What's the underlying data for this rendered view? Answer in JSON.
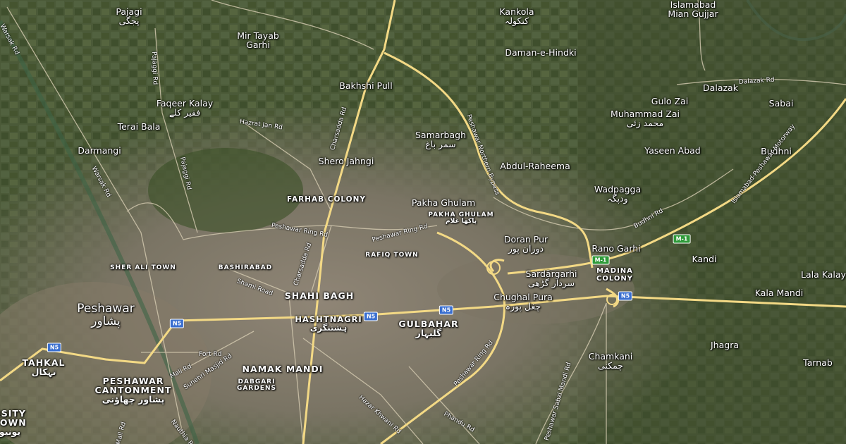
{
  "map": {
    "colors": {
      "terrain": "#4a5238",
      "urban": "#8a7f70",
      "highway": "#f3d985",
      "road": "#d8cdb4",
      "n5_shield": "#3a6fd0",
      "m1_shield": "#2f9a3a"
    },
    "places": [
      {
        "id": "pajagi",
        "en": "Pajagi",
        "ur": "پجگی"
      },
      {
        "id": "mir-tayab-garhi",
        "en": "Mir Tayab\nGarhi",
        "ur": ""
      },
      {
        "id": "kankola",
        "en": "Kankola",
        "ur": "کنکولہ"
      },
      {
        "id": "islamabad-mian-gujjar",
        "en": "Islamabad\nMian Gujjar",
        "ur": ""
      },
      {
        "id": "daman-e-hindki",
        "en": "Daman-e-Hindki",
        "ur": ""
      },
      {
        "id": "bakhshi-pull",
        "en": "Bakhshi Pull",
        "ur": ""
      },
      {
        "id": "faqeer-kalay",
        "en": "Faqeer Kalay",
        "ur": "فقیر کلے"
      },
      {
        "id": "terai-bala",
        "en": "Terai Bala",
        "ur": ""
      },
      {
        "id": "darmangi",
        "en": "Darmangi",
        "ur": ""
      },
      {
        "id": "dalazak",
        "en": "Dalazak",
        "ur": ""
      },
      {
        "id": "gulo-zai",
        "en": "Gulo Zai",
        "ur": ""
      },
      {
        "id": "sabai",
        "en": "Sabai",
        "ur": ""
      },
      {
        "id": "muhammad-zai",
        "en": "Muhammad Zai",
        "ur": "محمد زئی"
      },
      {
        "id": "samarbagh",
        "en": "Samarbagh",
        "ur": "سمر باغ"
      },
      {
        "id": "shero-jahngi",
        "en": "Shero Jahngi",
        "ur": ""
      },
      {
        "id": "yaseen-abad",
        "en": "Yaseen Abad",
        "ur": ""
      },
      {
        "id": "budhni",
        "en": "Budhni",
        "ur": ""
      },
      {
        "id": "abdul-raheema",
        "en": "Abdul-Raheema",
        "ur": ""
      },
      {
        "id": "wadpagga",
        "en": "Wadpagga",
        "ur": "ودپگہ"
      },
      {
        "id": "pakha-ghulam",
        "en": "Pakha Ghulam",
        "ur": ""
      },
      {
        "id": "doran-pur",
        "en": "Doran Pur",
        "ur": "دوران پور"
      },
      {
        "id": "rano-garhi",
        "en": "Rano Garhi",
        "ur": ""
      },
      {
        "id": "kandi",
        "en": "Kandi",
        "ur": ""
      },
      {
        "id": "lala-kalay",
        "en": "Lala Kalay",
        "ur": ""
      },
      {
        "id": "sardargarhi",
        "en": "Sardārgarhi",
        "ur": "سردار گڑھی"
      },
      {
        "id": "chughal-pura",
        "en": "Chughal Pura",
        "ur": "چغل پورہ"
      },
      {
        "id": "kala-mandi",
        "en": "Kala Mandi",
        "ur": ""
      },
      {
        "id": "peshawar",
        "en": "Peshawar",
        "ur": "پشاور"
      },
      {
        "id": "jhagra",
        "en": "Jhagra",
        "ur": ""
      },
      {
        "id": "chamkani",
        "en": "Chamkani",
        "ur": "چمکنی"
      },
      {
        "id": "tarnab",
        "en": "Tarnab",
        "ur": ""
      }
    ],
    "areas": [
      {
        "id": "farhab-colony",
        "en": "FARHAB COLONY",
        "ur": ""
      },
      {
        "id": "pakha-ghulam-area",
        "en": "PAKHA GHULAM",
        "ur": "پاکھا غلام"
      },
      {
        "id": "rafiq-town",
        "en": "RAFIQ TOWN",
        "ur": ""
      },
      {
        "id": "sher-ali-town",
        "en": "SHER ALI TOWN",
        "ur": ""
      },
      {
        "id": "bashirabad",
        "en": "BASHIRABAD",
        "ur": ""
      },
      {
        "id": "shahi-bagh",
        "en": "SHAHI BAGH",
        "ur": ""
      },
      {
        "id": "hashtnagri",
        "en": "HASHTNAGRI",
        "ur": "ہشتنگری"
      },
      {
        "id": "gulbahar",
        "en": "GULBAHAR",
        "ur": "گلبہار"
      },
      {
        "id": "madina-colony",
        "en": "MADINA\nCOLONY",
        "ur": ""
      },
      {
        "id": "tahkal",
        "en": "TAHKAL",
        "ur": "تہکال"
      },
      {
        "id": "peshawar-cantonment",
        "en": "PESHAWAR\nCANTONMENT",
        "ur": "پشاور چھاؤنی"
      },
      {
        "id": "namak-mandi",
        "en": "NAMAK MANDI",
        "ur": ""
      },
      {
        "id": "dabgari-gardens",
        "en": "DABGARI\nGARDENS",
        "ur": ""
      },
      {
        "id": "university-town",
        "en": "RSITY\nTOWN",
        "ur": "یونیو"
      }
    ],
    "roads": [
      {
        "id": "warsak-rd-top",
        "text": "Warsak Rd"
      },
      {
        "id": "pajaggi-rd-top",
        "text": "Pajaggi Rd"
      },
      {
        "id": "charsadda-rd-top",
        "text": "Charsadda Rd"
      },
      {
        "id": "hazrat-jan-rd",
        "text": "Hazrat Jan Rd"
      },
      {
        "id": "pajaggi-rd",
        "text": "Pajaggi Rd"
      },
      {
        "id": "warsak-rd",
        "text": "Warsak Rd"
      },
      {
        "id": "peshawar-northern-bypass",
        "text": "Peshawar Northern Bypass"
      },
      {
        "id": "dalazak-rd",
        "text": "Dalazak Rd"
      },
      {
        "id": "islamabad-peshawar-motorway",
        "text": "Islamabad-Peshawar Motorway"
      },
      {
        "id": "budhni-rd",
        "text": "Budhni Rd"
      },
      {
        "id": "peshawar-ring-rd-w",
        "text": "Peshawar Ring Rd"
      },
      {
        "id": "peshawar-ring-rd-n",
        "text": "Peshawar Ring Rd"
      },
      {
        "id": "charsadda-rd",
        "text": "Charsadda Rd"
      },
      {
        "id": "shami-road",
        "text": "Shami Road"
      },
      {
        "id": "fort-rd",
        "text": "Fort Rd"
      },
      {
        "id": "mall-rd",
        "text": "Mall Rd"
      },
      {
        "id": "sunehri-masjid-rd",
        "text": "Sunehri Masjid Rd"
      },
      {
        "id": "mall-rd-2",
        "text": "Mall Rd"
      },
      {
        "id": "nauthia-rd",
        "text": "Nauthia Rd"
      },
      {
        "id": "hazar-khwani-rd",
        "text": "Hazar Khwani Rd"
      },
      {
        "id": "peshawar-ring-rd-s",
        "text": "Peshawar Ring Rd"
      },
      {
        "id": "phandu-rd",
        "text": "Phandu Rd"
      },
      {
        "id": "peshawar-sabzi-mandi-rd",
        "text": "Peshawar Sabzi Mandi Rd"
      }
    ],
    "shields": [
      {
        "id": "n5-west",
        "text": "N5",
        "kind": "n5"
      },
      {
        "id": "n5-peshawar",
        "text": "N5",
        "kind": "n5"
      },
      {
        "id": "n5-hashtnagri",
        "text": "N5",
        "kind": "n5"
      },
      {
        "id": "n5-gulbahar",
        "text": "N5",
        "kind": "n5"
      },
      {
        "id": "n5-madina",
        "text": "N5",
        "kind": "n5"
      },
      {
        "id": "m1-rano",
        "text": "M-1",
        "kind": "m1"
      },
      {
        "id": "m1-east",
        "text": "M-1",
        "kind": "m1"
      }
    ]
  }
}
